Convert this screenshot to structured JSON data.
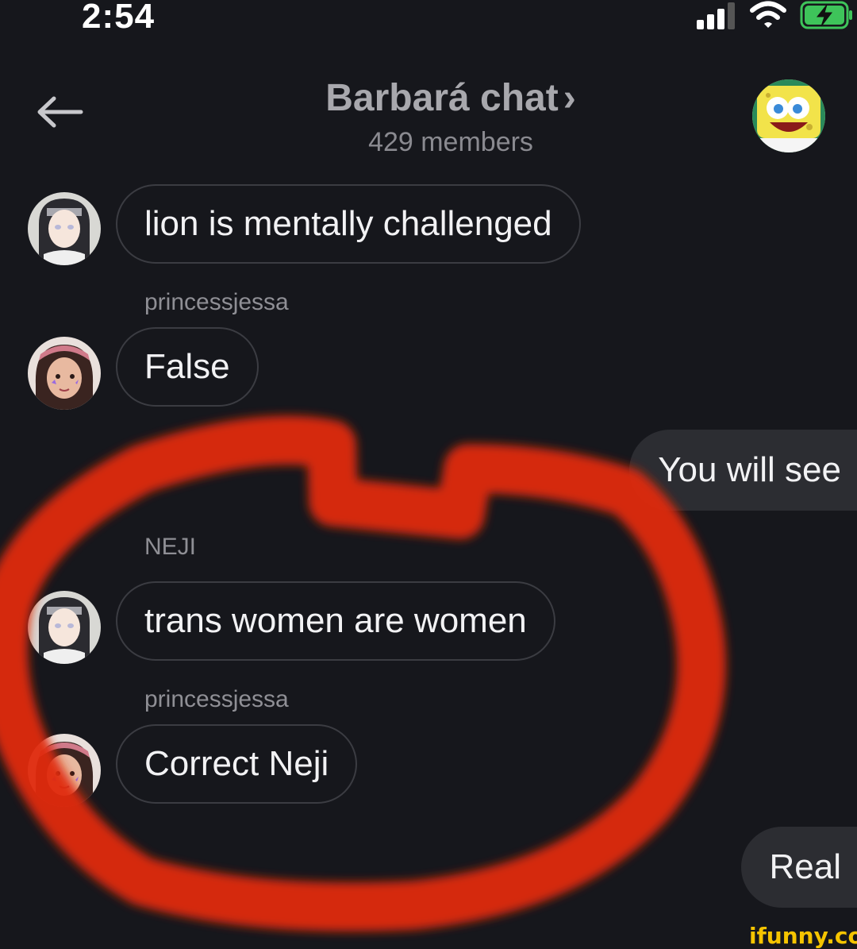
{
  "status_bar": {
    "time": "2:54"
  },
  "header": {
    "title": "Barbará chat",
    "chevron": "›",
    "subtitle": "429 members"
  },
  "messages": [
    {
      "sender": "",
      "text": "lion is mentally challenged",
      "avatar": "neji-avatar"
    },
    {
      "sender": "princessjessa",
      "text": "False",
      "avatar": "princessjessa-avatar"
    },
    {
      "outgoing": true,
      "text": "You will see"
    },
    {
      "sender": "NEJI",
      "text": "trans women are women",
      "avatar": "neji-avatar"
    },
    {
      "sender": "princessjessa",
      "text": "Correct Neji",
      "avatar": "princessjessa-avatar"
    },
    {
      "outgoing": true,
      "text": "Real"
    }
  ],
  "watermark": "ifunny.co",
  "colors": {
    "background": "#16171c",
    "bubble_border": "#3b3c42",
    "outgoing_bubble": "#2c2d32",
    "annotation": "#e02a10"
  }
}
